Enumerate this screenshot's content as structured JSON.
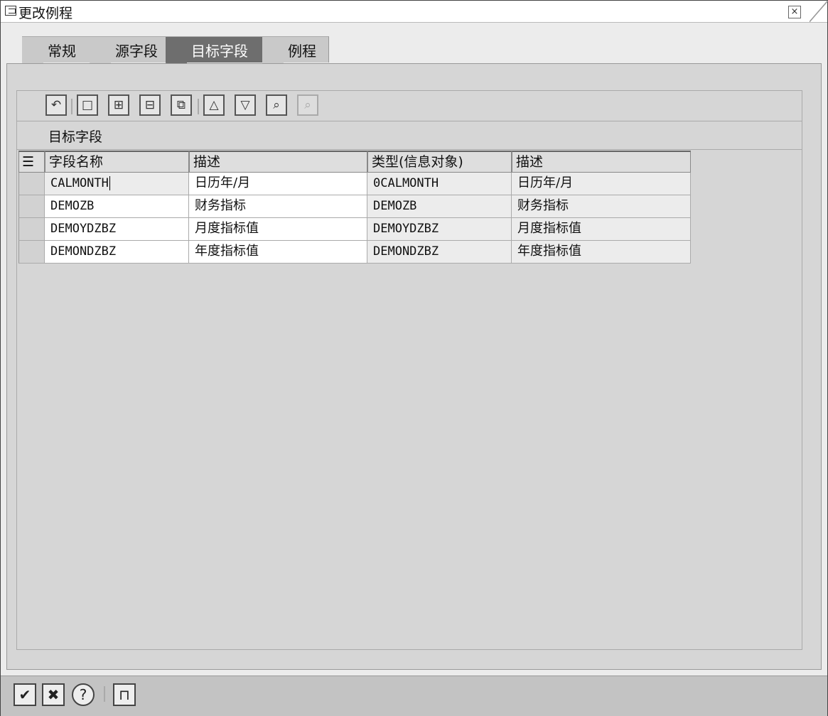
{
  "window": {
    "title": "更改例程",
    "close_icon": "close-icon"
  },
  "tabs": [
    {
      "label": "常规",
      "active": false
    },
    {
      "label": "源字段",
      "active": false
    },
    {
      "label": "目标字段",
      "active": true
    },
    {
      "label": "例程",
      "active": false
    }
  ],
  "toolbar": {
    "buttons": [
      {
        "icon": "undo-icon",
        "glyph": "↶"
      },
      {
        "icon": "new-document-icon",
        "glyph": "□"
      },
      {
        "icon": "insert-row-icon",
        "glyph": "⊞"
      },
      {
        "icon": "delete-row-icon",
        "glyph": "⊟"
      },
      {
        "icon": "copy-icon",
        "glyph": "⧉"
      },
      {
        "icon": "sort-ascending-icon",
        "glyph": "△"
      },
      {
        "icon": "filter-icon",
        "glyph": "▽"
      },
      {
        "icon": "find-icon",
        "glyph": "⌕"
      },
      {
        "icon": "find-next-icon",
        "glyph": "⌕",
        "disabled": true
      }
    ]
  },
  "grid": {
    "title": "目标字段",
    "columns": [
      "字段名称",
      "描述",
      "类型(信息对象)",
      "描述"
    ],
    "rows": [
      [
        "CALMONTH",
        "日历年/月",
        "0CALMONTH",
        "日历年/月"
      ],
      [
        "DEMOZB",
        "财务指标",
        "DEMOZB",
        "财务指标"
      ],
      [
        "DEMOYDZBZ",
        "月度指标值",
        "DEMOYDZBZ",
        "月度指标值"
      ],
      [
        "DEMONDZBZ",
        "年度指标值",
        "DEMONDZBZ",
        "年度指标值"
      ]
    ]
  },
  "footer": {
    "buttons": [
      {
        "icon": "confirm-check-icon",
        "glyph": "✔"
      },
      {
        "icon": "cancel-x-icon",
        "glyph": "✖"
      },
      {
        "icon": "help-icon",
        "glyph": "?"
      },
      {
        "icon": "hierarchy-icon",
        "glyph": "⊓"
      }
    ]
  }
}
